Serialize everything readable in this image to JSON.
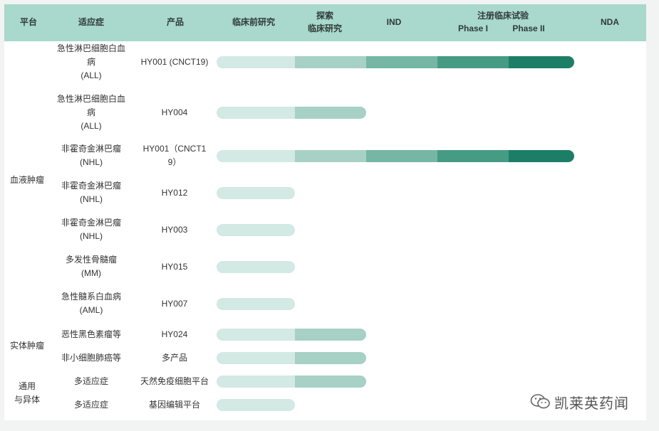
{
  "header": {
    "platform": "平台",
    "indication": "适应症",
    "product": "产品",
    "preclinical": "临床前研究",
    "exploratory_1": "探索",
    "exploratory_2": "临床研究",
    "ind": "IND",
    "registration": "注册临床试验",
    "phase1": "Phase I",
    "phase2": "Phase II",
    "nda": "NDA"
  },
  "colors": {
    "header_bg": "#a9d8cd",
    "stages": [
      "#d3e9e3",
      "#a6d1c4",
      "#76b6a4",
      "#469b84",
      "#1c7e66"
    ]
  },
  "platforms": [
    "血液肿瘤",
    "实体肿瘤",
    "通用\n与异体"
  ],
  "rows": [
    {
      "indication": "急性淋巴细胞白血\n病\n(ALL)",
      "product": "HY001 (CNCT19)"
    },
    {
      "indication": "急性淋巴细胞白血\n病\n(ALL)",
      "product": "HY004"
    },
    {
      "indication": "非霍奇金淋巴瘤\n(NHL)",
      "product": "HY001（CNCT1\n9）"
    },
    {
      "indication": "非霍奇金淋巴瘤\n(NHL)",
      "product": "HY012"
    },
    {
      "indication": "非霍奇金淋巴瘤\n(NHL)",
      "product": "HY003"
    },
    {
      "indication": "多发性骨髓瘤\n(MM)",
      "product": "HY015"
    },
    {
      "indication": "急性髓系白血病\n(AML)",
      "product": "HY007"
    },
    {
      "indication": "恶性黑色素瘤等",
      "product": "HY024"
    },
    {
      "indication": "非小细胞肺癌等",
      "product": "多产品"
    },
    {
      "indication": "多适应症",
      "product": "天然免疫细胞平台"
    },
    {
      "indication": "多适应症",
      "product": "基因编辑平台"
    }
  ],
  "chart_data": {
    "type": "bar",
    "stages": [
      "临床前研究",
      "探索临床研究",
      "IND",
      "Phase I",
      "Phase II",
      "NDA"
    ],
    "categories": [
      "HY001 (CNCT19)",
      "HY004",
      "HY001（CNCT19）",
      "HY012",
      "HY003",
      "HY015",
      "HY007",
      "HY024",
      "多产品",
      "天然免疫细胞平台",
      "基因编辑平台"
    ],
    "values": [
      5,
      2,
      5,
      1,
      1,
      1,
      1,
      2,
      2,
      2,
      1
    ]
  },
  "watermark": {
    "icon": "wechat-icon",
    "text": "凯莱英药闻"
  }
}
